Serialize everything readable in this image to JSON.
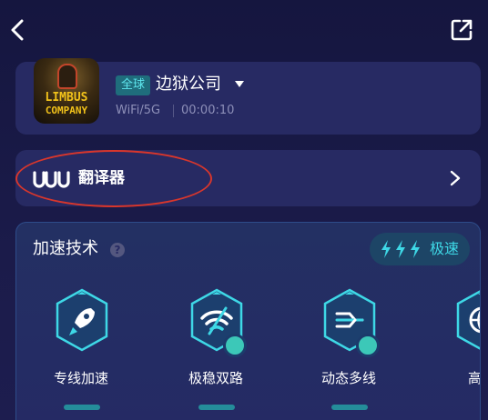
{
  "topbar": {
    "back_icon": "chevron-left-icon",
    "share_icon": "external-link-icon"
  },
  "game": {
    "cover_text_line1": "LIMBUS",
    "cover_text_line2": "COMPANY",
    "region_badge": "全球",
    "name": "边狱公司",
    "network": "WiFi/5G",
    "timer": "00:00:10"
  },
  "translator": {
    "label": "翻译器",
    "logo_icon": "uu-logo-icon",
    "chevron_icon": "chevron-right-icon"
  },
  "accel": {
    "title": "加速技术",
    "help_icon": "question-icon",
    "mode_label": "极速",
    "features": [
      {
        "label": "专线加速",
        "icon": "rocket-icon"
      },
      {
        "label": "极稳双路",
        "icon": "wifi-dual-icon"
      },
      {
        "label": "动态多线",
        "icon": "multi-line-icon"
      },
      {
        "label": "高速",
        "icon": "globe-icon"
      }
    ]
  },
  "colors": {
    "accent": "#3ed8e6",
    "card": "#272a63",
    "background": "#15163f",
    "highlight": "#d8362c"
  }
}
